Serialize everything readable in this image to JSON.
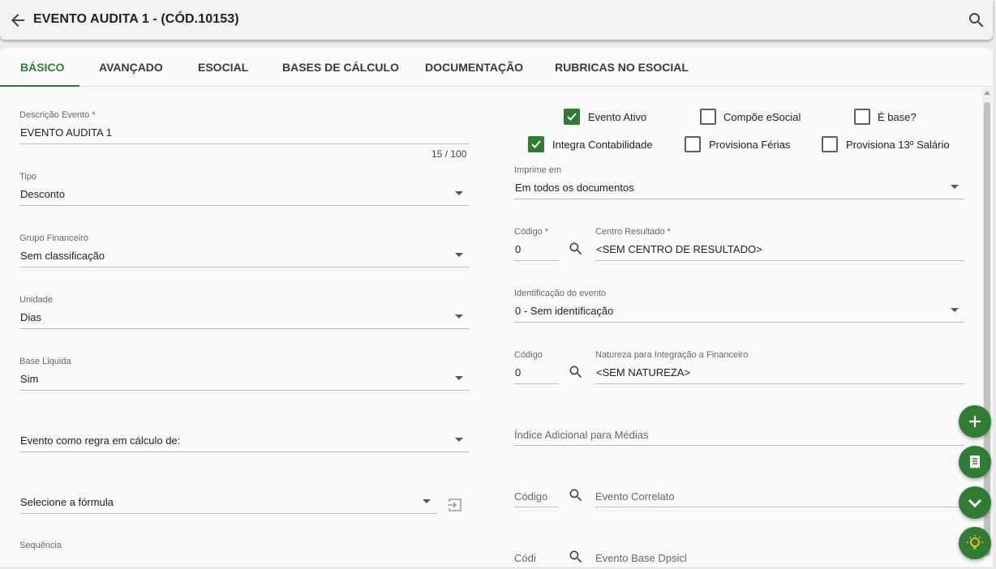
{
  "header": {
    "title": "EVENTO AUDITA 1 - (CÓD.10153)"
  },
  "tabs": [
    {
      "label": "BÁSICO"
    },
    {
      "label": "AVANÇADO"
    },
    {
      "label": "ESOCIAL"
    },
    {
      "label": "BASES DE CÁLCULO"
    },
    {
      "label": "DOCUMENTAÇÃO"
    },
    {
      "label": "RUBRICAS NO ESOCIAL"
    }
  ],
  "left": {
    "descricao": {
      "label": "Descrição Evento *",
      "value": "EVENTO AUDITA 1",
      "counter": "15 / 100"
    },
    "tipo": {
      "label": "Tipo",
      "value": "Desconto"
    },
    "grupo": {
      "label": "Grupo Financeiro",
      "value": "Sem classificação"
    },
    "unidade": {
      "label": "Unidade",
      "value": "Dias"
    },
    "base": {
      "label": "Base Liquida",
      "value": "Sim"
    },
    "regra": {
      "placeholder": "Evento como regra em cálculo de:"
    },
    "formula": {
      "placeholder": "Selecione a fórmula"
    },
    "sequencia": {
      "label": "Sequência"
    }
  },
  "checkboxes": [
    {
      "label": "Evento Ativo",
      "checked": true
    },
    {
      "label": "Compõe eSocial",
      "checked": false
    },
    {
      "label": "É base?",
      "checked": false
    },
    {
      "label": "Integra Contabilidade",
      "checked": true
    },
    {
      "label": "Provisiona Férias",
      "checked": false
    },
    {
      "label": "Provisiona 13º Salário",
      "checked": false
    }
  ],
  "right": {
    "imprime": {
      "label": "Imprime em",
      "value": "Em todos os documentos"
    },
    "codigo1": {
      "label": "Código *",
      "value": "0"
    },
    "centro": {
      "label": "Centro Resultado *",
      "value": "<SEM CENTRO DE RESULTADO>"
    },
    "identificacao": {
      "label": "Identificação do evento",
      "value": "0 - Sem identificação"
    },
    "codigo2": {
      "label": "Código",
      "value": "0"
    },
    "natureza": {
      "label": "Natureza para Integração a Financeiro",
      "value": "<SEM NATUREZA>"
    },
    "indice": {
      "placeholder": "Índice Adicional para Médias"
    },
    "codigo3": {
      "placeholder": "Código"
    },
    "correlato": {
      "placeholder": "Evento Correlato"
    },
    "codigo4": {
      "placeholder": "Códi"
    },
    "evento_dep": {
      "placeholder": "Evento Base Dpsicl"
    }
  },
  "icons": {
    "back": "arrow-left-icon",
    "search": "search-icon",
    "add": "plus-icon",
    "receipt": "receipt-icon",
    "chevron": "chevron-down-icon",
    "tip": "lightbulb-icon"
  },
  "colors": {
    "accent": "#2e7d32"
  }
}
